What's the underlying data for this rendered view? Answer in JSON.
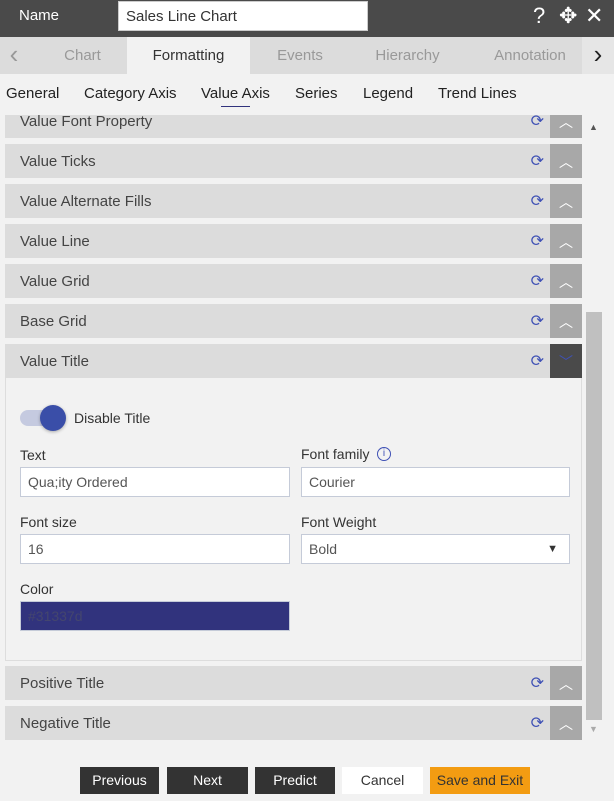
{
  "header": {
    "name_label": "Name",
    "name_value": "Sales Line Chart",
    "help_icon": "?",
    "move_icon": "✥",
    "close_icon": "✕"
  },
  "tabs": [
    {
      "label": "Chart"
    },
    {
      "label": "Formatting"
    },
    {
      "label": "Events"
    },
    {
      "label": "Hierarchy"
    },
    {
      "label": "Annotation"
    }
  ],
  "subtabs": [
    {
      "label": "General"
    },
    {
      "label": "Category Axis"
    },
    {
      "label": "Value Axis"
    },
    {
      "label": "Series"
    },
    {
      "label": "Legend"
    },
    {
      "label": "Trend Lines"
    }
  ],
  "sections": [
    {
      "label": "Value Font Property"
    },
    {
      "label": "Value Ticks"
    },
    {
      "label": "Value Alternate Fills"
    },
    {
      "label": "Value Line"
    },
    {
      "label": "Value Grid"
    },
    {
      "label": "Base Grid"
    },
    {
      "label": "Value Title"
    },
    {
      "label": "Positive Title"
    },
    {
      "label": "Negative Title"
    }
  ],
  "value_title": {
    "toggle_label": "Disable Title",
    "toggle_on": true,
    "text_label": "Text",
    "text_value": "Qua;ity Ordered",
    "font_family_label": "Font family",
    "font_family_value": "Courier",
    "font_size_label": "Font size",
    "font_size_value": "16",
    "font_weight_label": "Font Weight",
    "font_weight_value": "Bold",
    "color_label": "Color",
    "color_value": "#31337d"
  },
  "footer": {
    "previous": "Previous",
    "next": "Next",
    "predict": "Predict",
    "cancel": "Cancel",
    "save_exit": "Save and Exit"
  },
  "colors": {
    "accent": "#3f51b5",
    "save": "#f39c12"
  }
}
